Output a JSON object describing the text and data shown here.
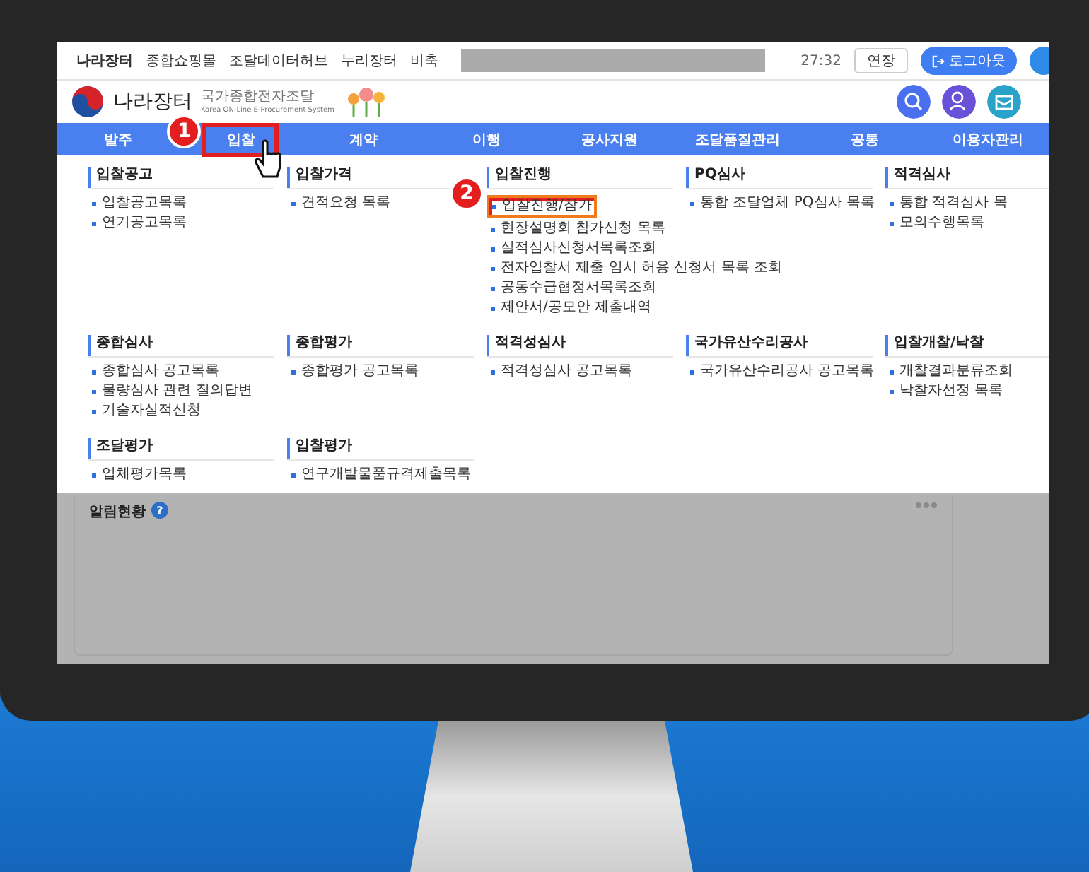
{
  "top_links": [
    "나라장터",
    "종합쇼핑몰",
    "조달데이터허브",
    "누리장터",
    "비축"
  ],
  "session": {
    "time": "27:32",
    "extend_button": "연장",
    "logout_button": "로그아웃"
  },
  "logo": {
    "title": "나라장터",
    "subtitle": "국가종합전자조달",
    "english": "Korea ON-Line E-Procurement System"
  },
  "nav": [
    {
      "label": "발주",
      "selected": false
    },
    {
      "label": "입찰",
      "selected": true,
      "step": "1"
    },
    {
      "label": "계약",
      "selected": false
    },
    {
      "label": "이행",
      "selected": false
    },
    {
      "label": "공사지원",
      "selected": false
    },
    {
      "label": "조달품질관리",
      "selected": false
    },
    {
      "label": "공통",
      "selected": false
    },
    {
      "label": "이용자관리",
      "selected": false
    }
  ],
  "menu_rows": [
    [
      {
        "title": "입찰공고",
        "items": [
          {
            "label": "입찰공고목록",
            "highlighted": false
          },
          {
            "label": "연기공고목록",
            "highlighted": false
          }
        ]
      },
      {
        "title": "입찰가격",
        "items": [
          {
            "label": "견적요청 목록",
            "highlighted": false
          }
        ]
      },
      {
        "title": "입찰진행",
        "items": [
          {
            "label": "입찰진행/참가",
            "highlighted": true,
            "step": "2"
          },
          {
            "label": "현장설명회 참가신청 목록",
            "highlighted": false
          },
          {
            "label": "실적심사신청서목록조회",
            "highlighted": false
          },
          {
            "label": "전자입찰서 제출 임시 허용 신청서 목록 조회",
            "highlighted": false
          },
          {
            "label": "공동수급협정서목록조회",
            "highlighted": false
          },
          {
            "label": "제안서/공모안 제출내역",
            "highlighted": false
          }
        ]
      },
      {
        "title": "PQ심사",
        "items": [
          {
            "label": "통합 조달업체 PQ심사 목록",
            "highlighted": false
          }
        ]
      },
      {
        "title": "적격심사",
        "items": [
          {
            "label": "통합 적격심사 목",
            "highlighted": false
          },
          {
            "label": "모의수행목록",
            "highlighted": false
          }
        ]
      }
    ],
    [
      {
        "title": "종합심사",
        "items": [
          {
            "label": "종합심사 공고목록",
            "highlighted": false
          },
          {
            "label": "물량심사 관련 질의답변",
            "highlighted": false
          },
          {
            "label": "기술자실적신청",
            "highlighted": false
          }
        ]
      },
      {
        "title": "종합평가",
        "items": [
          {
            "label": "종합평가 공고목록",
            "highlighted": false
          }
        ]
      },
      {
        "title": "적격성심사",
        "items": [
          {
            "label": "적격성심사 공고목록",
            "highlighted": false
          }
        ]
      },
      {
        "title": "국가유산수리공사",
        "items": [
          {
            "label": "국가유산수리공사 공고목록",
            "highlighted": false
          }
        ]
      },
      {
        "title": "입찰개찰/낙찰",
        "items": [
          {
            "label": "개찰결과분류조회",
            "highlighted": false
          },
          {
            "label": "낙찰자선정 목록",
            "highlighted": false
          }
        ]
      }
    ],
    [
      {
        "title": "조달평가",
        "items": [
          {
            "label": "업체평가목록",
            "highlighted": false
          }
        ]
      },
      {
        "title": "입찰평가",
        "items": [
          {
            "label": "연구개발물품규격제출목록",
            "highlighted": false
          }
        ]
      }
    ]
  ],
  "panel": {
    "title": "알림현황",
    "help_icon": "?"
  }
}
